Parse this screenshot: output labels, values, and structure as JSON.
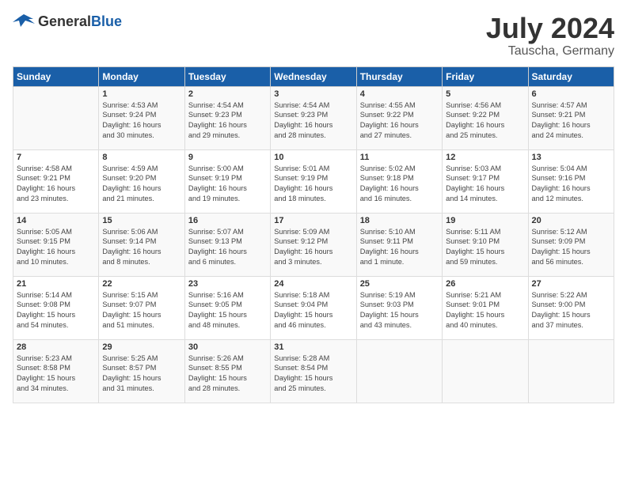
{
  "header": {
    "logo_general": "General",
    "logo_blue": "Blue",
    "month": "July 2024",
    "location": "Tauscha, Germany"
  },
  "weekdays": [
    "Sunday",
    "Monday",
    "Tuesday",
    "Wednesday",
    "Thursday",
    "Friday",
    "Saturday"
  ],
  "weeks": [
    [
      {
        "day": "",
        "text": ""
      },
      {
        "day": "1",
        "text": "Sunrise: 4:53 AM\nSunset: 9:24 PM\nDaylight: 16 hours\nand 30 minutes."
      },
      {
        "day": "2",
        "text": "Sunrise: 4:54 AM\nSunset: 9:23 PM\nDaylight: 16 hours\nand 29 minutes."
      },
      {
        "day": "3",
        "text": "Sunrise: 4:54 AM\nSunset: 9:23 PM\nDaylight: 16 hours\nand 28 minutes."
      },
      {
        "day": "4",
        "text": "Sunrise: 4:55 AM\nSunset: 9:22 PM\nDaylight: 16 hours\nand 27 minutes."
      },
      {
        "day": "5",
        "text": "Sunrise: 4:56 AM\nSunset: 9:22 PM\nDaylight: 16 hours\nand 25 minutes."
      },
      {
        "day": "6",
        "text": "Sunrise: 4:57 AM\nSunset: 9:21 PM\nDaylight: 16 hours\nand 24 minutes."
      }
    ],
    [
      {
        "day": "7",
        "text": "Sunrise: 4:58 AM\nSunset: 9:21 PM\nDaylight: 16 hours\nand 23 minutes."
      },
      {
        "day": "8",
        "text": "Sunrise: 4:59 AM\nSunset: 9:20 PM\nDaylight: 16 hours\nand 21 minutes."
      },
      {
        "day": "9",
        "text": "Sunrise: 5:00 AM\nSunset: 9:19 PM\nDaylight: 16 hours\nand 19 minutes."
      },
      {
        "day": "10",
        "text": "Sunrise: 5:01 AM\nSunset: 9:19 PM\nDaylight: 16 hours\nand 18 minutes."
      },
      {
        "day": "11",
        "text": "Sunrise: 5:02 AM\nSunset: 9:18 PM\nDaylight: 16 hours\nand 16 minutes."
      },
      {
        "day": "12",
        "text": "Sunrise: 5:03 AM\nSunset: 9:17 PM\nDaylight: 16 hours\nand 14 minutes."
      },
      {
        "day": "13",
        "text": "Sunrise: 5:04 AM\nSunset: 9:16 PM\nDaylight: 16 hours\nand 12 minutes."
      }
    ],
    [
      {
        "day": "14",
        "text": "Sunrise: 5:05 AM\nSunset: 9:15 PM\nDaylight: 16 hours\nand 10 minutes."
      },
      {
        "day": "15",
        "text": "Sunrise: 5:06 AM\nSunset: 9:14 PM\nDaylight: 16 hours\nand 8 minutes."
      },
      {
        "day": "16",
        "text": "Sunrise: 5:07 AM\nSunset: 9:13 PM\nDaylight: 16 hours\nand 6 minutes."
      },
      {
        "day": "17",
        "text": "Sunrise: 5:09 AM\nSunset: 9:12 PM\nDaylight: 16 hours\nand 3 minutes."
      },
      {
        "day": "18",
        "text": "Sunrise: 5:10 AM\nSunset: 9:11 PM\nDaylight: 16 hours\nand 1 minute."
      },
      {
        "day": "19",
        "text": "Sunrise: 5:11 AM\nSunset: 9:10 PM\nDaylight: 15 hours\nand 59 minutes."
      },
      {
        "day": "20",
        "text": "Sunrise: 5:12 AM\nSunset: 9:09 PM\nDaylight: 15 hours\nand 56 minutes."
      }
    ],
    [
      {
        "day": "21",
        "text": "Sunrise: 5:14 AM\nSunset: 9:08 PM\nDaylight: 15 hours\nand 54 minutes."
      },
      {
        "day": "22",
        "text": "Sunrise: 5:15 AM\nSunset: 9:07 PM\nDaylight: 15 hours\nand 51 minutes."
      },
      {
        "day": "23",
        "text": "Sunrise: 5:16 AM\nSunset: 9:05 PM\nDaylight: 15 hours\nand 48 minutes."
      },
      {
        "day": "24",
        "text": "Sunrise: 5:18 AM\nSunset: 9:04 PM\nDaylight: 15 hours\nand 46 minutes."
      },
      {
        "day": "25",
        "text": "Sunrise: 5:19 AM\nSunset: 9:03 PM\nDaylight: 15 hours\nand 43 minutes."
      },
      {
        "day": "26",
        "text": "Sunrise: 5:21 AM\nSunset: 9:01 PM\nDaylight: 15 hours\nand 40 minutes."
      },
      {
        "day": "27",
        "text": "Sunrise: 5:22 AM\nSunset: 9:00 PM\nDaylight: 15 hours\nand 37 minutes."
      }
    ],
    [
      {
        "day": "28",
        "text": "Sunrise: 5:23 AM\nSunset: 8:58 PM\nDaylight: 15 hours\nand 34 minutes."
      },
      {
        "day": "29",
        "text": "Sunrise: 5:25 AM\nSunset: 8:57 PM\nDaylight: 15 hours\nand 31 minutes."
      },
      {
        "day": "30",
        "text": "Sunrise: 5:26 AM\nSunset: 8:55 PM\nDaylight: 15 hours\nand 28 minutes."
      },
      {
        "day": "31",
        "text": "Sunrise: 5:28 AM\nSunset: 8:54 PM\nDaylight: 15 hours\nand 25 minutes."
      },
      {
        "day": "",
        "text": ""
      },
      {
        "day": "",
        "text": ""
      },
      {
        "day": "",
        "text": ""
      }
    ]
  ]
}
